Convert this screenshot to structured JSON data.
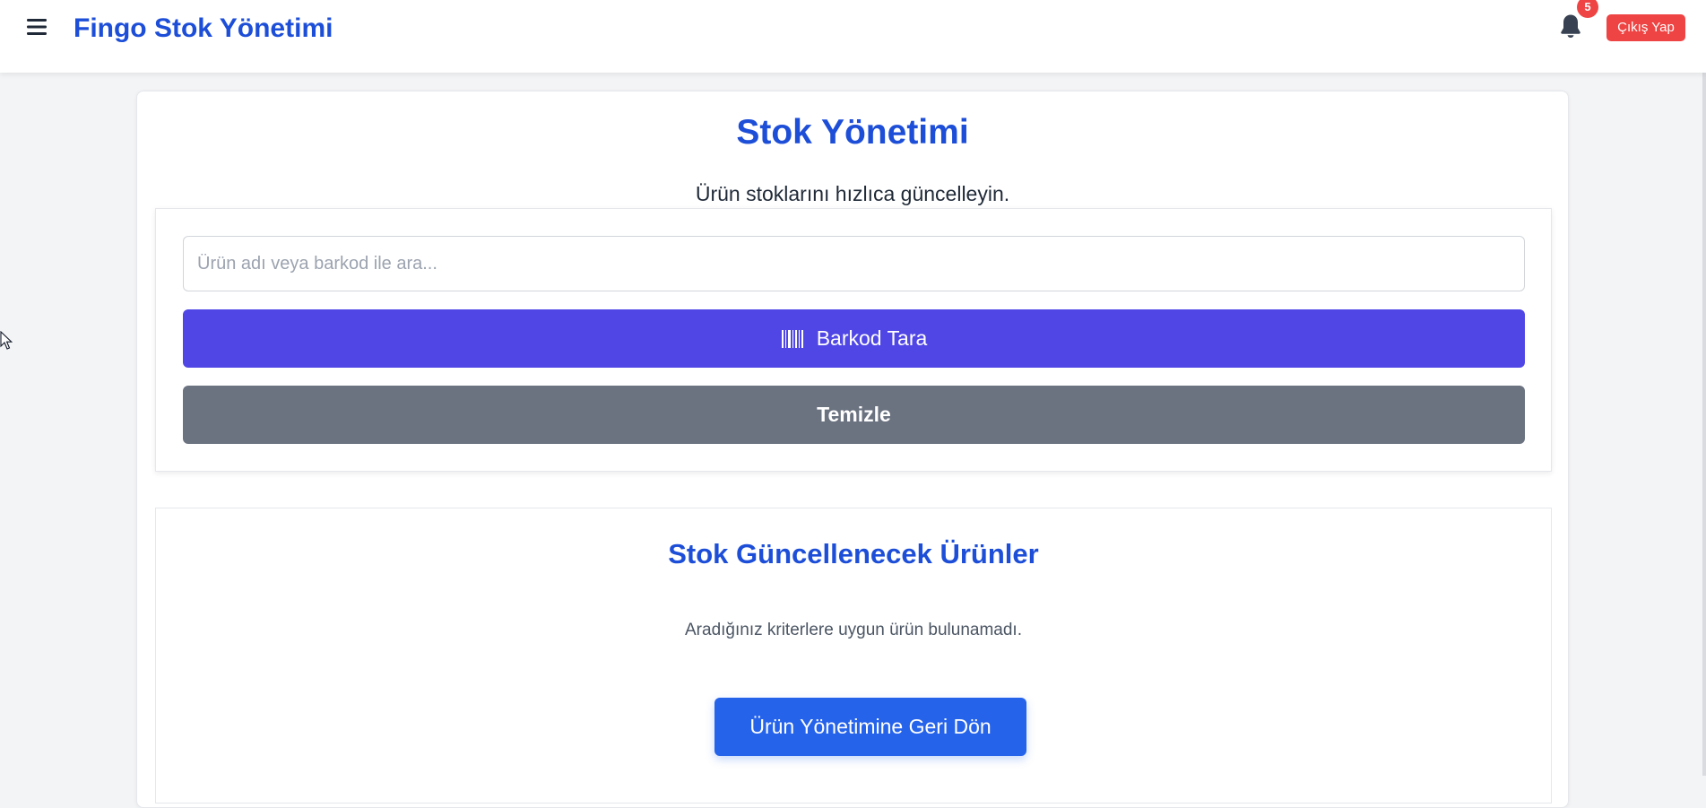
{
  "header": {
    "app_title": "Fingo Stok Yönetimi",
    "menu_icon": "hamburger-menu-icon",
    "bell_icon": "bell-icon",
    "notification_count": "5",
    "logout_label": "Çıkış Yap"
  },
  "main": {
    "title": "Stok Yönetimi",
    "subtitle": "Ürün stoklarını hızlıca güncelleyin.",
    "search": {
      "placeholder": "Ürün adı veya barkod ile ara...",
      "value": ""
    },
    "scan_button": {
      "icon": "barcode-icon",
      "label": "Barkod Tara"
    },
    "clear_button_label": "Temizle",
    "products": {
      "title": "Stok Güncellenecek Ürünler",
      "empty_message": "Aradığınız kriterlere uygun ürün bulunamadı.",
      "back_button_label": "Ürün Yönetimine Geri Dön"
    }
  },
  "colors": {
    "brand_blue": "#1d4ed8",
    "primary_blue": "#2563eb",
    "indigo": "#4f46e5",
    "gray_button": "#6b7280",
    "danger_red": "#ef4444",
    "page_background": "#f3f4f6"
  }
}
